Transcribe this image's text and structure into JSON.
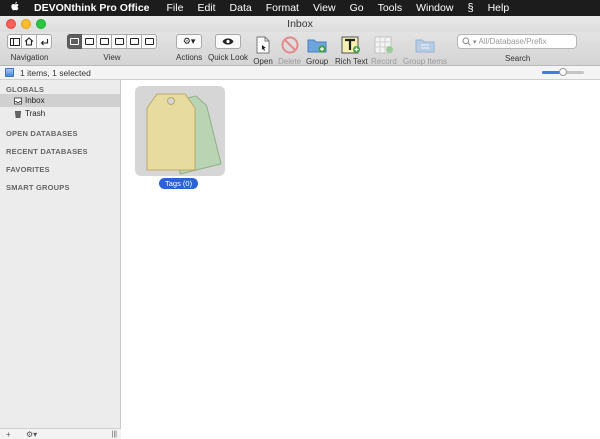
{
  "menubar": {
    "app_name": "DEVONthink Pro Office",
    "items": [
      "File",
      "Edit",
      "Data",
      "Format",
      "View",
      "Go",
      "Tools",
      "Window"
    ],
    "script_glyph": "§",
    "help": "Help"
  },
  "window": {
    "title": "Inbox"
  },
  "toolbar": {
    "navigation_label": "Navigation",
    "view_label": "View",
    "actions_label": "Actions",
    "quicklook_label": "Quick Look",
    "open_label": "Open",
    "delete_label": "Delete",
    "group_label": "Group",
    "richtext_label": "Rich Text",
    "record_label": "Record",
    "groupitems_label": "Group Items",
    "search_label": "Search",
    "search_placeholder": "All/Database/Prefix",
    "actions_glyph": "⚙▾"
  },
  "status": {
    "text": "1 items, 1 selected",
    "zoom_fraction": 0.5
  },
  "sidebar": {
    "globals": "GLOBALS",
    "items": [
      {
        "label": "Inbox"
      },
      {
        "label": "Trash"
      }
    ],
    "open_databases": "OPEN DATABASES",
    "recent_databases": "RECENT DATABASES",
    "favorites": "FAVORITES",
    "smart_groups": "SMART GROUPS",
    "bottom_add": "+",
    "bottom_gear": "⚙▾",
    "bottom_grip": "|||"
  },
  "content": {
    "item_label": "Tags (0)"
  },
  "colors": {
    "selection_blue": "#2b63d6",
    "tag_front": "#e8dba0",
    "tag_back": "#b8d4b2"
  }
}
